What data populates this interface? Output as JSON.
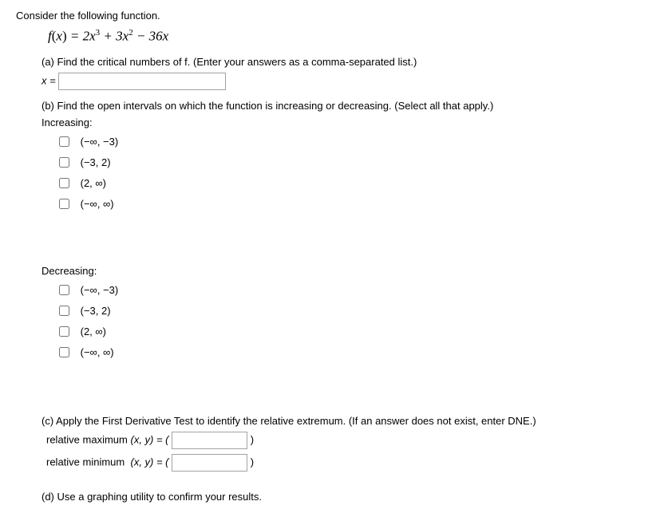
{
  "intro": "Consider the following function.",
  "formula_html": "f(x) = 2x³ + 3x² − 36x",
  "part_a": "(a) Find the critical numbers of f. (Enter your answers as a comma-separated list.)",
  "x_label": "x = ",
  "part_b": "(b) Find the open intervals on which the function is increasing or decreasing. (Select all that apply.)",
  "increasing_label": "Increasing:",
  "decreasing_label": "Decreasing:",
  "intervals": {
    "opt1": "(−∞, −3)",
    "opt2": "(−3, 2)",
    "opt3": "(2, ∞)",
    "opt4": "(−∞, ∞)"
  },
  "part_c": "(c) Apply the First Derivative Test to identify the relative extremum. (If an answer does not exist, enter DNE.)",
  "rel_max_label": "relative maximum",
  "rel_min_label": "relative minimum",
  "xy_eq": "(x, y) = (",
  "close_paren": ")",
  "part_d": "(d) Use a graphing utility to confirm your results."
}
